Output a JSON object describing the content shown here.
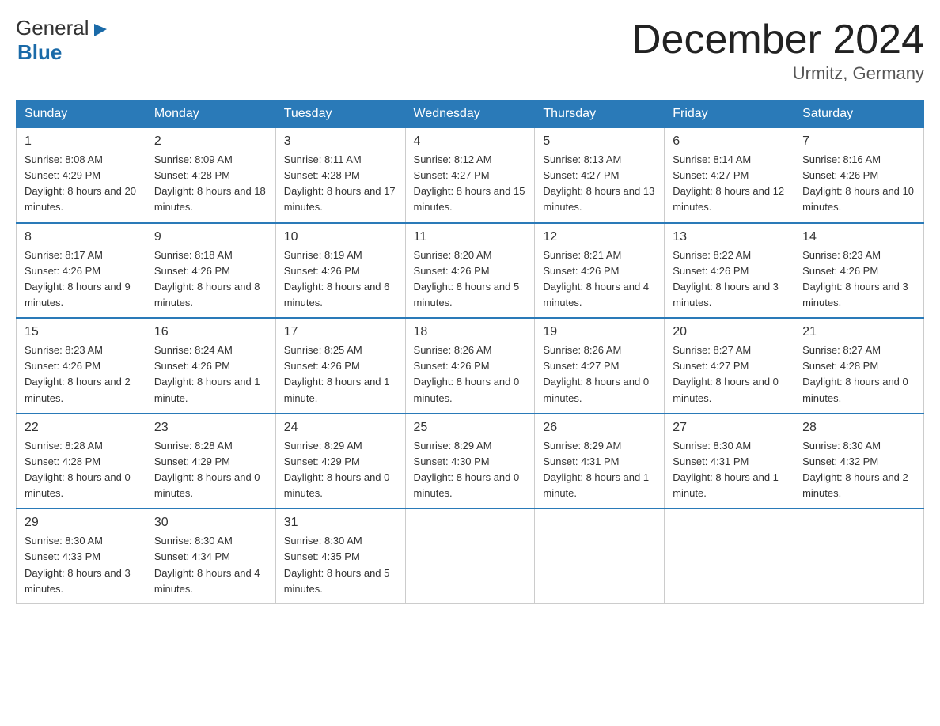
{
  "header": {
    "logo_general": "General",
    "logo_blue": "Blue",
    "month_title": "December 2024",
    "location": "Urmitz, Germany"
  },
  "days_of_week": [
    "Sunday",
    "Monday",
    "Tuesday",
    "Wednesday",
    "Thursday",
    "Friday",
    "Saturday"
  ],
  "weeks": [
    [
      {
        "day": "1",
        "sunrise": "8:08 AM",
        "sunset": "4:29 PM",
        "daylight": "8 hours and 20 minutes."
      },
      {
        "day": "2",
        "sunrise": "8:09 AM",
        "sunset": "4:28 PM",
        "daylight": "8 hours and 18 minutes."
      },
      {
        "day": "3",
        "sunrise": "8:11 AM",
        "sunset": "4:28 PM",
        "daylight": "8 hours and 17 minutes."
      },
      {
        "day": "4",
        "sunrise": "8:12 AM",
        "sunset": "4:27 PM",
        "daylight": "8 hours and 15 minutes."
      },
      {
        "day": "5",
        "sunrise": "8:13 AM",
        "sunset": "4:27 PM",
        "daylight": "8 hours and 13 minutes."
      },
      {
        "day": "6",
        "sunrise": "8:14 AM",
        "sunset": "4:27 PM",
        "daylight": "8 hours and 12 minutes."
      },
      {
        "day": "7",
        "sunrise": "8:16 AM",
        "sunset": "4:26 PM",
        "daylight": "8 hours and 10 minutes."
      }
    ],
    [
      {
        "day": "8",
        "sunrise": "8:17 AM",
        "sunset": "4:26 PM",
        "daylight": "8 hours and 9 minutes."
      },
      {
        "day": "9",
        "sunrise": "8:18 AM",
        "sunset": "4:26 PM",
        "daylight": "8 hours and 8 minutes."
      },
      {
        "day": "10",
        "sunrise": "8:19 AM",
        "sunset": "4:26 PM",
        "daylight": "8 hours and 6 minutes."
      },
      {
        "day": "11",
        "sunrise": "8:20 AM",
        "sunset": "4:26 PM",
        "daylight": "8 hours and 5 minutes."
      },
      {
        "day": "12",
        "sunrise": "8:21 AM",
        "sunset": "4:26 PM",
        "daylight": "8 hours and 4 minutes."
      },
      {
        "day": "13",
        "sunrise": "8:22 AM",
        "sunset": "4:26 PM",
        "daylight": "8 hours and 3 minutes."
      },
      {
        "day": "14",
        "sunrise": "8:23 AM",
        "sunset": "4:26 PM",
        "daylight": "8 hours and 3 minutes."
      }
    ],
    [
      {
        "day": "15",
        "sunrise": "8:23 AM",
        "sunset": "4:26 PM",
        "daylight": "8 hours and 2 minutes."
      },
      {
        "day": "16",
        "sunrise": "8:24 AM",
        "sunset": "4:26 PM",
        "daylight": "8 hours and 1 minute."
      },
      {
        "day": "17",
        "sunrise": "8:25 AM",
        "sunset": "4:26 PM",
        "daylight": "8 hours and 1 minute."
      },
      {
        "day": "18",
        "sunrise": "8:26 AM",
        "sunset": "4:26 PM",
        "daylight": "8 hours and 0 minutes."
      },
      {
        "day": "19",
        "sunrise": "8:26 AM",
        "sunset": "4:27 PM",
        "daylight": "8 hours and 0 minutes."
      },
      {
        "day": "20",
        "sunrise": "8:27 AM",
        "sunset": "4:27 PM",
        "daylight": "8 hours and 0 minutes."
      },
      {
        "day": "21",
        "sunrise": "8:27 AM",
        "sunset": "4:28 PM",
        "daylight": "8 hours and 0 minutes."
      }
    ],
    [
      {
        "day": "22",
        "sunrise": "8:28 AM",
        "sunset": "4:28 PM",
        "daylight": "8 hours and 0 minutes."
      },
      {
        "day": "23",
        "sunrise": "8:28 AM",
        "sunset": "4:29 PM",
        "daylight": "8 hours and 0 minutes."
      },
      {
        "day": "24",
        "sunrise": "8:29 AM",
        "sunset": "4:29 PM",
        "daylight": "8 hours and 0 minutes."
      },
      {
        "day": "25",
        "sunrise": "8:29 AM",
        "sunset": "4:30 PM",
        "daylight": "8 hours and 0 minutes."
      },
      {
        "day": "26",
        "sunrise": "8:29 AM",
        "sunset": "4:31 PM",
        "daylight": "8 hours and 1 minute."
      },
      {
        "day": "27",
        "sunrise": "8:30 AM",
        "sunset": "4:31 PM",
        "daylight": "8 hours and 1 minute."
      },
      {
        "day": "28",
        "sunrise": "8:30 AM",
        "sunset": "4:32 PM",
        "daylight": "8 hours and 2 minutes."
      }
    ],
    [
      {
        "day": "29",
        "sunrise": "8:30 AM",
        "sunset": "4:33 PM",
        "daylight": "8 hours and 3 minutes."
      },
      {
        "day": "30",
        "sunrise": "8:30 AM",
        "sunset": "4:34 PM",
        "daylight": "8 hours and 4 minutes."
      },
      {
        "day": "31",
        "sunrise": "8:30 AM",
        "sunset": "4:35 PM",
        "daylight": "8 hours and 5 minutes."
      },
      null,
      null,
      null,
      null
    ]
  ]
}
